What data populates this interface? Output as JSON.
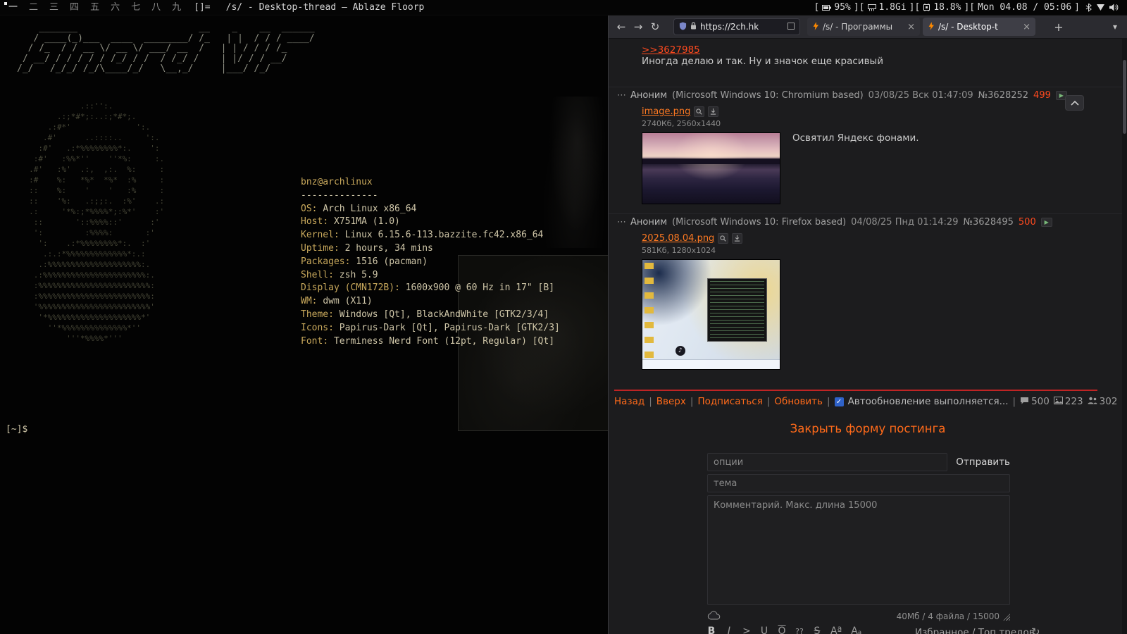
{
  "colors": {
    "accent_orange": "#ff6a1a",
    "reply_red": "#ff4a1f",
    "new_posts_marker_red": "#bf2424",
    "checkbox_blue": "#2f62c9",
    "fetch_label_gold": "#c9a95c",
    "fetch_value_tan": "#cfc6a8"
  },
  "statusbar": {
    "tags": [
      "一",
      "二",
      "三",
      "四",
      "五",
      "六",
      "七",
      "八",
      "九"
    ],
    "layout": "[]=",
    "window_title": "/s/ - Desktop-thread — Ablaze Floorp",
    "battery": "95%",
    "memory": "1.8Gi",
    "cpu": "18.8%",
    "clock": "Mon 04.08 / 05:06"
  },
  "terminal": {
    "banner": [
      "    _______                      __    _    __  ______",
      "   / ____(_)___  ____  ________/ /_   | |  / / / ____/",
      "  / /_  / / __ \\/ __ \\/ ___/ __  /   | | / / / /_",
      " / __/ / / / / / /_/ / /  / /_/ /    | |/ / / __/",
      "/_/   /_/_/ /_/\\____/_/   \\__,_/     |___/ /_/"
    ],
    "face_art": [
      "                .::'':.",
      "           .:;*#*;:..:;*#*;.",
      "         .:#*'              ':.",
      "        .#'      ..::::..     ':.",
      "       :#'   .:*%%%%%%%%*:.    ':",
      "      :#'   :%%*''    ''*%:     :.",
      "     .#'   :%'  .:,  ,:.  %:     :",
      "     :#    %:   *%*  *%*  :%     :",
      "     ::    %:    '    '   :%     :",
      "     ::    '%:   .:;;:.  :%'    .:",
      "     .:     '*%:;*%%%%*;:%*'    :'",
      "      ::       '::%%%%::'      :'",
      "      ':         :%%%%:       :'",
      "       ':    .:*%%%%%%%%*:.  :'",
      "        .:.:*%%%%%%%%%%%%%*:.:",
      "       .:%%%%%%%%%%%%%%%%%%%%:.",
      "      .:%%%%%%%%%%%%%%%%%%%%%%:.",
      "      :%%%%%%%%%%%%%%%%%%%%%%%%:",
      "      :%%%%%%%%%%%%%%%%%%%%%%%%:",
      "      '%%%%%%%%%%%%%%%%%%%%%%%%'",
      "       '*%%%%%%%%%%%%%%%%%%%%*'",
      "         ''*%%%%%%%%%%%%%%*''",
      "             '''*%%%%*'''"
    ],
    "fetch": {
      "title": "bnz@archlinux",
      "separator": "--------------",
      "entries": [
        {
          "label": "OS",
          "value": "Arch Linux x86_64"
        },
        {
          "label": "Host",
          "value": "X751MA (1.0)"
        },
        {
          "label": "Kernel",
          "value": "Linux 6.15.6-113.bazzite.fc42.x86_64"
        },
        {
          "label": "Uptime",
          "value": "2 hours, 34 mins"
        },
        {
          "label": "Packages",
          "value": "1516 (pacman)"
        },
        {
          "label": "Shell",
          "value": "zsh 5.9"
        },
        {
          "label": "Display (CMN172B)",
          "value": "1600x900 @ 60 Hz in 17\" [B]"
        },
        {
          "label": "WM",
          "value": "dwm (X11)"
        },
        {
          "label": "Theme",
          "value": "Windows [Qt], BlackAndWhite [GTK2/3/4]"
        },
        {
          "label": "Icons",
          "value": "Papirus-Dark [Qt], Papirus-Dark [GTK2/3]"
        },
        {
          "label": "Font",
          "value": "Terminess Nerd Font (12pt, Regular) [Qt]"
        }
      ]
    },
    "prompt": "[~]$"
  },
  "browser": {
    "url": "https://2ch.hk",
    "tabs": [
      {
        "title": "/s/ - Программы",
        "active": false
      },
      {
        "title": "/s/ - Desktop-t",
        "active": true
      }
    ]
  },
  "thread": {
    "top_post": {
      "reply_link": ">>3627985",
      "text": "Иногда делаю и так. Ну и значок еще красивый"
    },
    "posts": [
      {
        "name": "Аноним",
        "agent": "(Microsoft Windows 10: Chromium based)",
        "date": "03/08/25 Вск 01:47:09",
        "number": "№3628252",
        "ordinal": "499",
        "file": {
          "name": "image.png",
          "size": "2740Кб, 2560x1440"
        },
        "text": "Освятил Яндекс фонами."
      },
      {
        "name": "Аноним",
        "agent": "(Microsoft Windows 10: Firefox based)",
        "date": "04/08/25 Пнд 01:14:29",
        "number": "№3628495",
        "ordinal": "500",
        "file": {
          "name": "2025.08.04.png",
          "size": "581Кб, 1280x1024"
        },
        "text": ""
      }
    ],
    "nav": {
      "links": [
        "Назад",
        "Вверх",
        "Подписаться",
        "Обновить"
      ],
      "autoupdate_label": "Автообновление выполняется...",
      "counts": {
        "posts": "500",
        "images": "223",
        "posters": "302"
      }
    },
    "form": {
      "close_label": "Закрыть форму постинга",
      "options_placeholder": "опции",
      "submit_label": "Отправить",
      "subject_placeholder": "тема",
      "comment_placeholder": "Комментарий. Макс. длина 15000",
      "limits": "40Мб / 4 файла / 15000",
      "toolbar": [
        "B",
        "I",
        ">",
        "U",
        "O",
        "??",
        "S",
        "Aª",
        "Aₐ"
      ],
      "favorites_label": "Избранное / Топ тредов"
    }
  }
}
